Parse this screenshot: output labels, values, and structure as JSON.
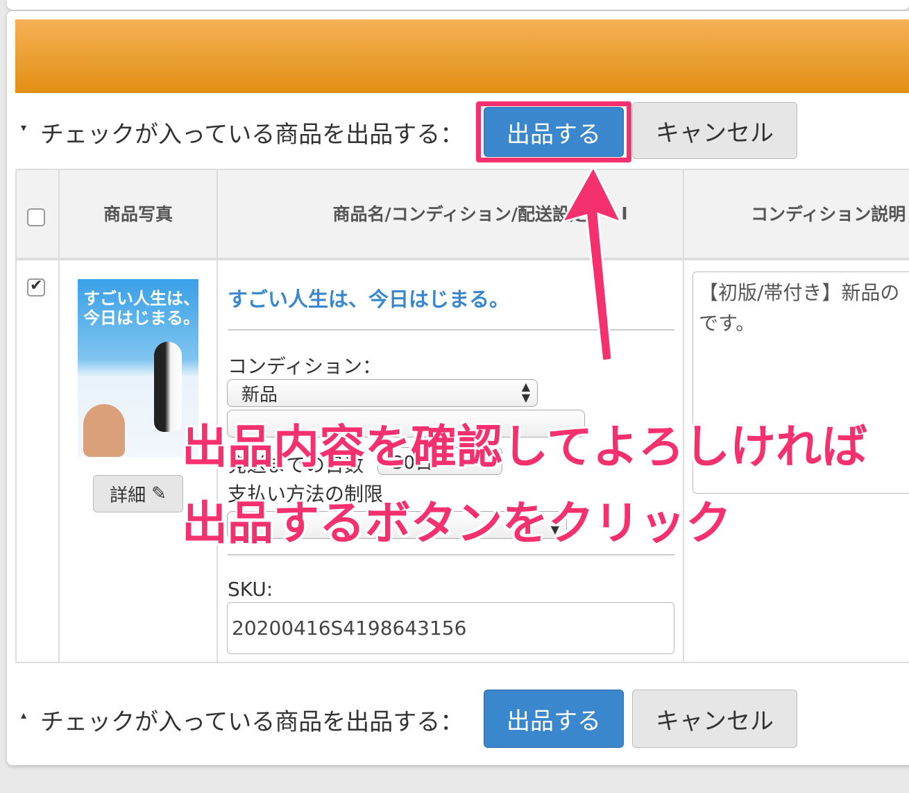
{
  "top_action": {
    "caret": "▾",
    "prompt": "チェックが入っている商品を出品する：",
    "submit_label": "出品する",
    "cancel_label": "キャンセル"
  },
  "bottom_action": {
    "caret": "▴",
    "prompt": "チェックが入っている商品を出品する：",
    "submit_label": "出品する",
    "cancel_label": "キャンセル"
  },
  "table": {
    "headers": [
      "商品写真",
      "商品名/コンディション/配送設定",
      "コンディション説明"
    ],
    "header_extra": "I",
    "header_checked": false,
    "row": {
      "checked": true,
      "book_title_line1": "すごい人生は、",
      "book_title_line2": "今日はじまる。",
      "detail_label": "詳細",
      "title": "すごい人生は、今日はじまる。",
      "condition_label": "コンディション：",
      "condition_value": "新品",
      "shipping_days_label": "発送までの日数",
      "shipping_days_value": "30日",
      "payment_label": "支払い方法の制限",
      "sku_label": "SKU:",
      "sku_value": "20200416S4198643156",
      "condition_note": "【初版/帯付き】新品の",
      "condition_note_line2": "です。"
    }
  },
  "annotation": {
    "line1": "出品内容を確認してよろしければ",
    "line2": "出品するボタンをクリック",
    "color": "#f5306f"
  },
  "colors": {
    "header_gradient_top": "#f4b155",
    "header_gradient_bottom": "#e38f14",
    "primary": "#3a87cd",
    "highlight": "#f5306f"
  }
}
